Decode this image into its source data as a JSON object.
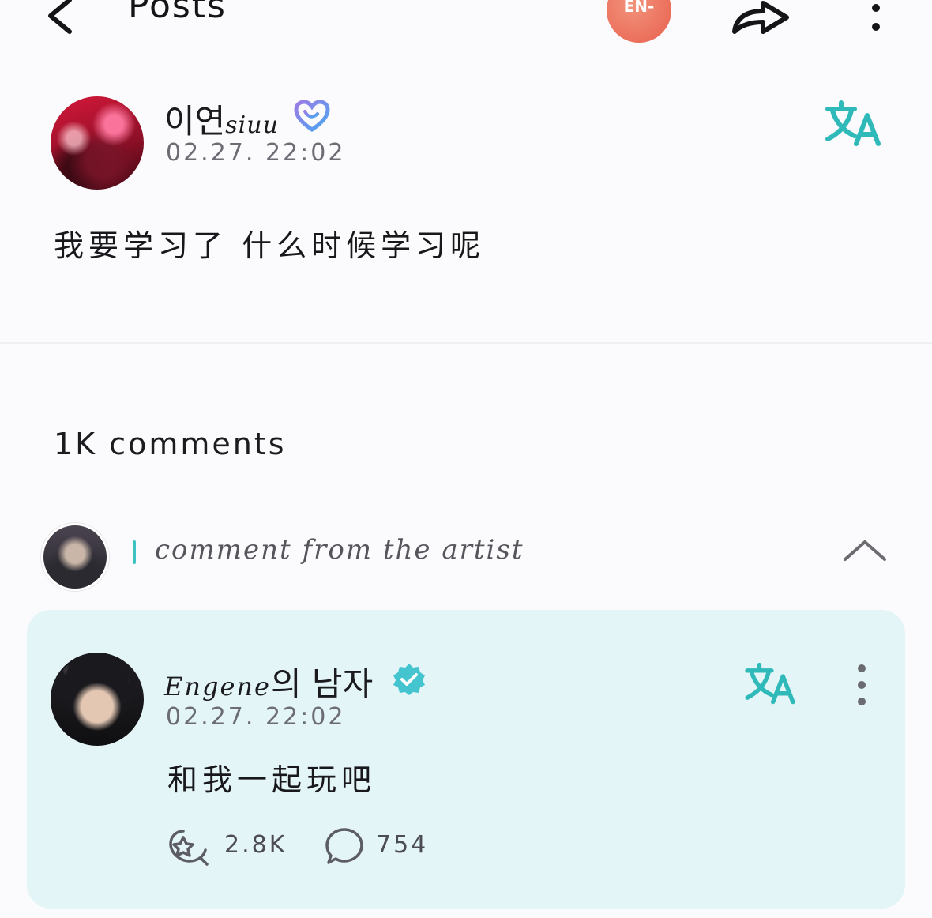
{
  "header": {
    "title": "Posts",
    "brand_logo_text": "EN-"
  },
  "post": {
    "author_name": "이연",
    "author_suffix": "siuu",
    "timestamp": "02.27. 22:02",
    "content": "我要学习了 什么时候学习呢"
  },
  "comments": {
    "count_label": "1K comments",
    "artist_section_label": "comment from the artist",
    "artist_comment": {
      "author_prefix": "Engene",
      "author_suffix": "의 남자",
      "timestamp": "02.27. 22:02",
      "content": "和我一起玩吧",
      "likes": "2.8K",
      "replies": "754"
    }
  },
  "colors": {
    "accent": "#3ec3c5",
    "card_background": "#e3f5f7",
    "brand": "#ec6b57"
  },
  "icons": [
    "back-arrow-icon",
    "share-icon",
    "more-vertical-icon",
    "heart-badge-icon",
    "translate-icon",
    "chevron-up-icon",
    "verified-icon",
    "like-icon",
    "comment-icon"
  ]
}
